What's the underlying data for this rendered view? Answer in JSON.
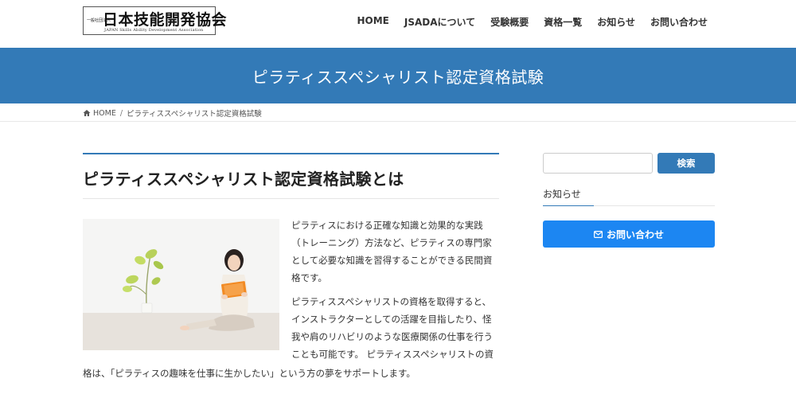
{
  "logo": {
    "prefix": "一般社団法人",
    "name": "日本技能開発協会",
    "subtitle": "JAPAN Skills Ability Development Association"
  },
  "nav": [
    {
      "label": "HOME"
    },
    {
      "label": "JSADAについて"
    },
    {
      "label": "受験概要"
    },
    {
      "label": "資格一覧"
    },
    {
      "label": "お知らせ"
    },
    {
      "label": "お問い合わせ"
    }
  ],
  "page_title": "ピラティススペシャリスト認定資格試験",
  "breadcrumb": {
    "home": "HOME",
    "current": "ピラティススペシャリスト認定資格試験"
  },
  "main": {
    "heading": "ピラティススペシャリスト認定資格試験とは",
    "paragraph1": "ピラティスにおける正確な知識と効果的な実践（トレーニング）方法など、ピラティスの専門家として必要な知識を習得することができる民間資格です。",
    "paragraph2": "ピラティススペシャリストの資格を取得すると、インストラクターとしての活躍を目指したり、怪我や肩のリハビリのような医療関係の仕事を行うことも可能です。 ピラティススペシャリストの資",
    "paragraph2_end": "格は、「ピラティスの趣味を仕事に生かしたい」という方の夢をサポートします。"
  },
  "sidebar": {
    "search_placeholder": "",
    "search_button": "検索",
    "news_title": "お知らせ",
    "contact_button": "お問い合わせ"
  },
  "colors": {
    "primary": "#337ab7",
    "contact_button": "#1c86f2"
  }
}
